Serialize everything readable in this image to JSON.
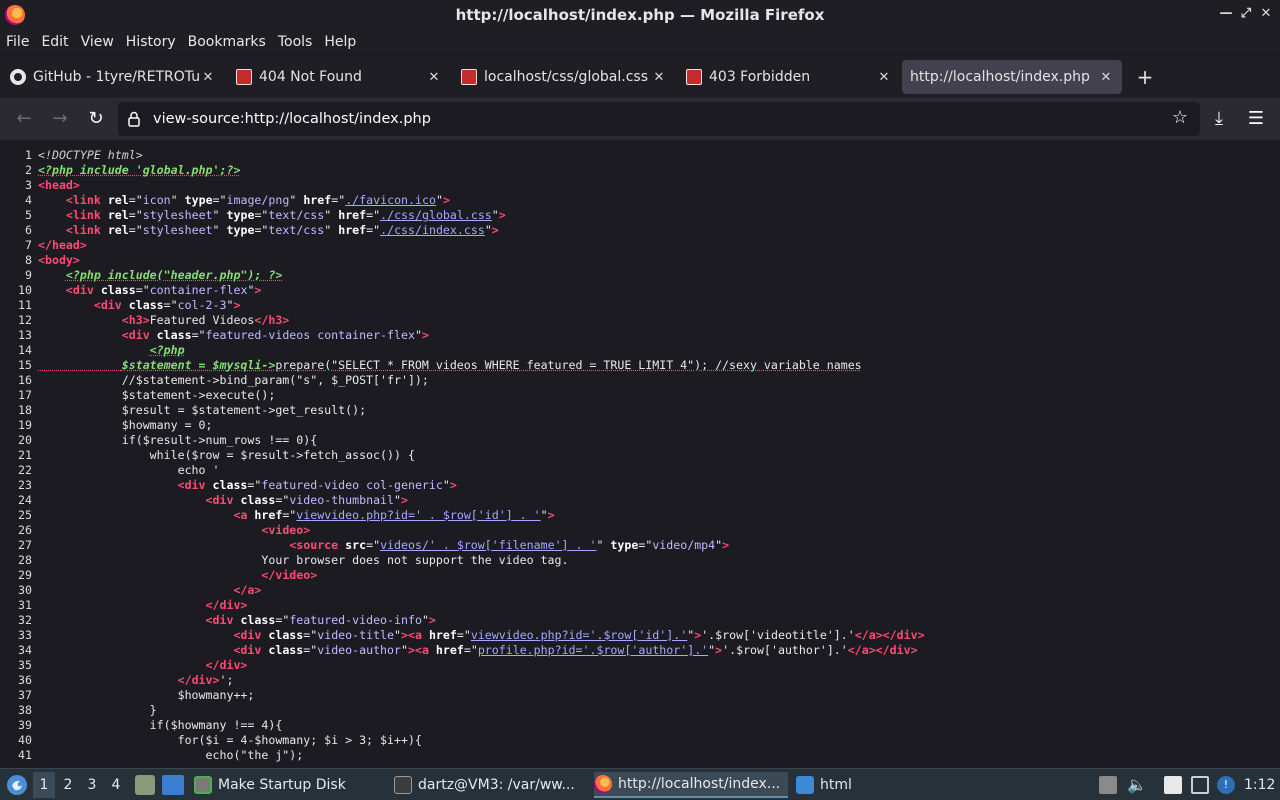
{
  "window": {
    "title": "http://localhost/index.php — Mozilla Firefox"
  },
  "menu": [
    "File",
    "Edit",
    "View",
    "History",
    "Bookmarks",
    "Tools",
    "Help"
  ],
  "tabs": [
    {
      "title": "GitHub - 1tyre/RETROTube",
      "favicon": "github-icon",
      "active": false
    },
    {
      "title": "404 Not Found",
      "favicon": "retrotube-icon",
      "active": false
    },
    {
      "title": "localhost/css/global.css",
      "favicon": "retrotube-icon",
      "active": false
    },
    {
      "title": "403 Forbidden",
      "favicon": "retrotube-icon",
      "active": false
    },
    {
      "title": "http://localhost/index.php",
      "favicon": "none",
      "active": true
    }
  ],
  "urlbar": {
    "url": "view-source:http://localhost/index.php"
  },
  "source_lines": [
    "1",
    "2",
    "3",
    "4",
    "5",
    "6",
    "7",
    "8",
    "9",
    "10",
    "11",
    "12",
    "13",
    "14",
    "15",
    "16",
    "17",
    "18",
    "19",
    "20",
    "21",
    "22",
    "23",
    "24",
    "25",
    "26",
    "27",
    "28",
    "29",
    "30",
    "31",
    "32",
    "33",
    "34",
    "35",
    "36",
    "37",
    "38",
    "39",
    "40",
    "41"
  ],
  "code": {
    "l1": "<!DOCTYPE html>",
    "l2": "<?php include 'global.php';?>",
    "l9": "<?php include(\"header.php\"); ?>",
    "l14": "<?php",
    "l15a": "$statement = $mysqli->",
    "l15b": "prepare(\"SELECT * FROM videos WHERE featured = TRUE LIMIT 4\"); //sexy variable names",
    "l16": "            //$statement->bind_param(\"s\", $_POST['fr']);",
    "l17": "            $statement->execute();",
    "l18": "            $result = $statement->get_result();",
    "l19": "            $howmany = 0;",
    "l20": "            if($result->num_rows !== 0){",
    "l21": "                while($row = $result->fetch_assoc()) {",
    "l22": "                    echo '",
    "l28": "                                Your browser does not support the video tag.",
    "l36b": "';",
    "l37": "                    $howmany++;",
    "l38": "                }",
    "l39": "                if($howmany !== 4){",
    "l40": "                    for($i = 4-$howmany; $i > 3; $i++){",
    "l41": "                        echo(\"the j\");",
    "h3text": "Featured Videos",
    "href_favicon": "./favicon.ico",
    "href_global": "./css/global.css",
    "href_index": "./css/index.css",
    "href_view1": "viewvideo.php?id=' . $row['id'] . '",
    "src_video": "videos/' . $row['filename'] . '",
    "href_view2": "viewvideo.php?id='.$row['id'].'",
    "href_profile": "profile.php?id='.$row['author'].'",
    "title_php": "'.$row['videotitle'].'",
    "author_php": "'.$row['author'].'"
  },
  "taskbar": {
    "workspaces": [
      "1",
      "2",
      "3",
      "4"
    ],
    "items": [
      {
        "label": "Make Startup Disk",
        "icon": "usb-creator-icon"
      },
      {
        "label": "dartz@VM3: /var/ww...",
        "icon": "terminal-icon"
      },
      {
        "label": "http://localhost/index...",
        "icon": "firefox-icon"
      },
      {
        "label": "html",
        "icon": "folder-icon"
      }
    ],
    "clock": "1:12"
  }
}
